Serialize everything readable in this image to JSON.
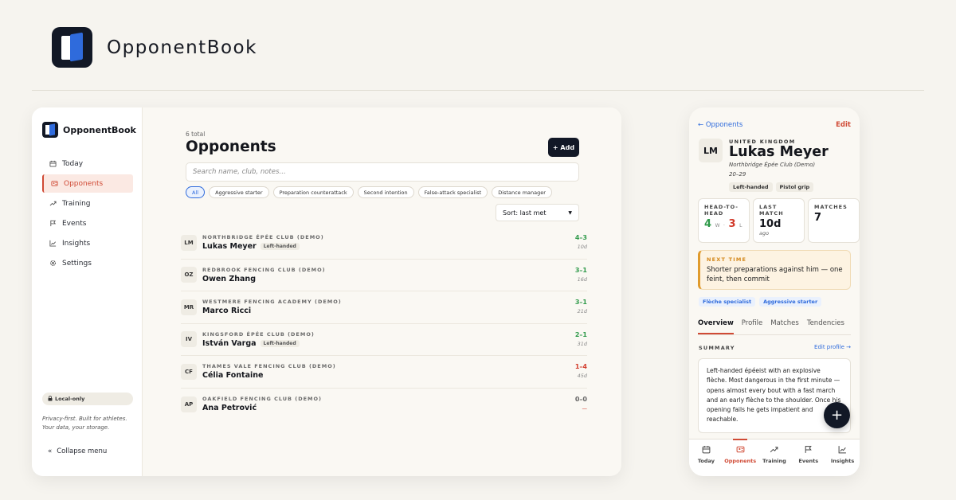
{
  "brand": {
    "name": "OpponentBook"
  },
  "sidebar": {
    "title": "OpponentBook",
    "items": [
      {
        "icon": "calendar-icon",
        "label": "Today",
        "active": false
      },
      {
        "icon": "contact-card-icon",
        "label": "Opponents",
        "active": true
      },
      {
        "icon": "trend-up-icon",
        "label": "Training",
        "active": false
      },
      {
        "icon": "flag-icon",
        "label": "Events",
        "active": false
      },
      {
        "icon": "chart-icon",
        "label": "Insights",
        "active": false
      },
      {
        "icon": "gear-icon",
        "label": "Settings",
        "active": false
      }
    ],
    "local_badge": "Local-only",
    "tagline": "Privacy-first. Built for athletes. Your data, your storage.",
    "collapse_label": "Collapse menu"
  },
  "main": {
    "total": "6 total",
    "title": "Opponents",
    "add_label": "+ Add",
    "search_placeholder": "Search name, club, notes…",
    "chips": [
      "All",
      "Aggressive starter",
      "Preparation counterattack",
      "Second intention",
      "False-attack specialist",
      "Distance manager"
    ],
    "sort": "Sort: last met",
    "rows": [
      {
        "initials": "LM",
        "club": "NORTHBRIDGE ÉPÉE CLUB (DEMO)",
        "name": "Lukas Meyer",
        "tag": "Left-handed",
        "score": "4–3",
        "ago": "10d",
        "result": "win"
      },
      {
        "initials": "OZ",
        "club": "REDBROOK FENCING CLUB (DEMO)",
        "name": "Owen Zhang",
        "tag": "",
        "score": "3–1",
        "ago": "16d",
        "result": "win"
      },
      {
        "initials": "MR",
        "club": "WESTMERE FENCING ACADEMY (DEMO)",
        "name": "Marco Ricci",
        "tag": "",
        "score": "3–1",
        "ago": "21d",
        "result": "win"
      },
      {
        "initials": "IV",
        "club": "KINGSFORD ÉPÉE CLUB (DEMO)",
        "name": "István Varga",
        "tag": "Left-handed",
        "score": "2–1",
        "ago": "31d",
        "result": "win"
      },
      {
        "initials": "CF",
        "club": "THAMES VALE FENCING CLUB (DEMO)",
        "name": "Célia Fontaine",
        "tag": "",
        "score": "1–4",
        "ago": "45d",
        "result": "loss"
      },
      {
        "initials": "AP",
        "club": "OAKFIELD FENCING CLUB (DEMO)",
        "name": "Ana Petrović",
        "tag": "",
        "score": "0–0",
        "ago": "—",
        "result": "none"
      }
    ]
  },
  "phone": {
    "back": "← Opponents",
    "edit": "Edit",
    "initials": "LM",
    "country": "UNITED KINGDOM",
    "name": "Lukas Meyer",
    "club": "Northbridge Épée Club (Demo)",
    "age": "20–29",
    "tags": [
      "Left-handed",
      "Pistol grip"
    ],
    "h2h_label": "HEAD-TO-HEAD",
    "h2h_w": "4",
    "h2h_w_unit": "W",
    "h2h_sep": "·",
    "h2h_l": "3",
    "h2h_l_unit": "L",
    "last_label": "LAST MATCH",
    "last_value": "10d",
    "last_sub": "ago",
    "matches_label": "MATCHES",
    "matches_value": "7",
    "next_label": "NEXT TIME",
    "next_text": "Shorter preparations against him — one feint, then commit",
    "style_chips": [
      "Flèche specialist",
      "Aggressive starter"
    ],
    "tabs": [
      "Overview",
      "Profile",
      "Matches",
      "Tendencies"
    ],
    "summary_label": "SUMMARY",
    "summary_edit": "Edit profile →",
    "summary": "Left-handed épéeist with an explosive flèche. Most dangerous in the first minute — opens almost every bout with a fast march and an early flèche to the shoulder. Once his opening fails he gets impatient and reachable.",
    "fab": "+",
    "bottom_nav": [
      {
        "icon": "calendar-icon",
        "label": "Today",
        "active": false
      },
      {
        "icon": "contact-card-icon",
        "label": "Opponents",
        "active": true
      },
      {
        "icon": "trend-up-icon",
        "label": "Training",
        "active": false
      },
      {
        "icon": "flag-icon",
        "label": "Events",
        "active": false
      },
      {
        "icon": "chart-icon",
        "label": "Insights",
        "active": false
      }
    ]
  },
  "colors": {
    "accent": "#d04a35",
    "link": "#2f6bdc",
    "win": "#2f9a4a",
    "loss": "#d23a2a",
    "dark": "#121826"
  }
}
